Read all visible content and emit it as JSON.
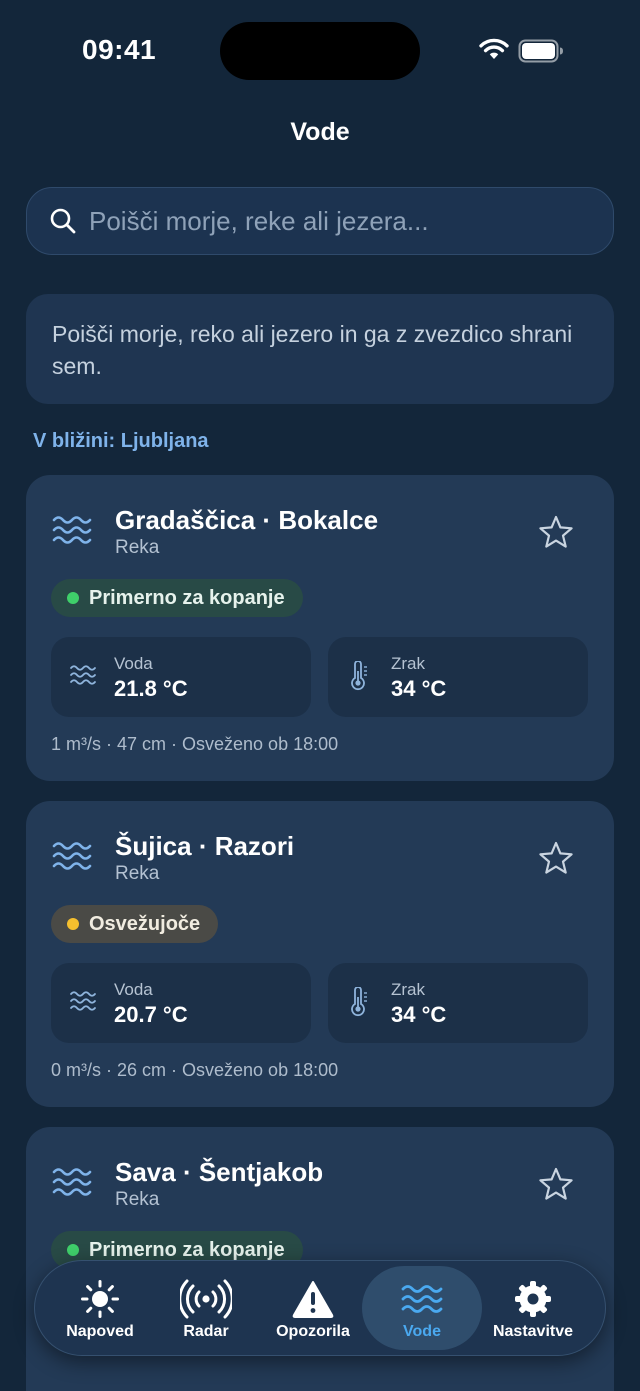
{
  "status": {
    "time": "09:41"
  },
  "header": {
    "title": "Vode"
  },
  "search": {
    "placeholder": "Poišči morje, reke ali jezera..."
  },
  "hint": {
    "text": "Poišči morje, reko ali jezero in ga z zvezdico shrani sem."
  },
  "nearby": {
    "label": "V bližini: Ljubljana"
  },
  "cards": [
    {
      "name": "Gradaščica · Bokalce",
      "type": "Reka",
      "badge": "Primerno za kopanje",
      "badge_color": "#3fcf6a",
      "water_label": "Voda",
      "water_value": "21.8 °C",
      "air_label": "Zrak",
      "air_value": "34 °C",
      "footer": "1 m³/s · 47 cm · Osveženo ob 18:00"
    },
    {
      "name": "Šujica · Razori",
      "type": "Reka",
      "badge": "Osvežujoče",
      "badge_color": "#f5bf2e",
      "water_label": "Voda",
      "water_value": "20.7 °C",
      "air_label": "Zrak",
      "air_value": "34 °C",
      "footer": "0 m³/s · 26 cm · Osveženo ob 18:00"
    },
    {
      "name": "Sava · Šentjakob",
      "type": "Reka",
      "badge": "Primerno za kopanje",
      "badge_color": "#3fcf6a"
    }
  ],
  "tabs": [
    {
      "label": "Napoved",
      "icon": "sun-icon",
      "active": false
    },
    {
      "label": "Radar",
      "icon": "radar-icon",
      "active": false
    },
    {
      "label": "Opozorila",
      "icon": "warning-icon",
      "active": false
    },
    {
      "label": "Vode",
      "icon": "waves-icon",
      "active": true
    },
    {
      "label": "Nastavitve",
      "icon": "gear-icon",
      "active": false
    }
  ],
  "colors": {
    "background": "#13263a",
    "card": "#233a56",
    "accent": "#4aa9f0"
  }
}
